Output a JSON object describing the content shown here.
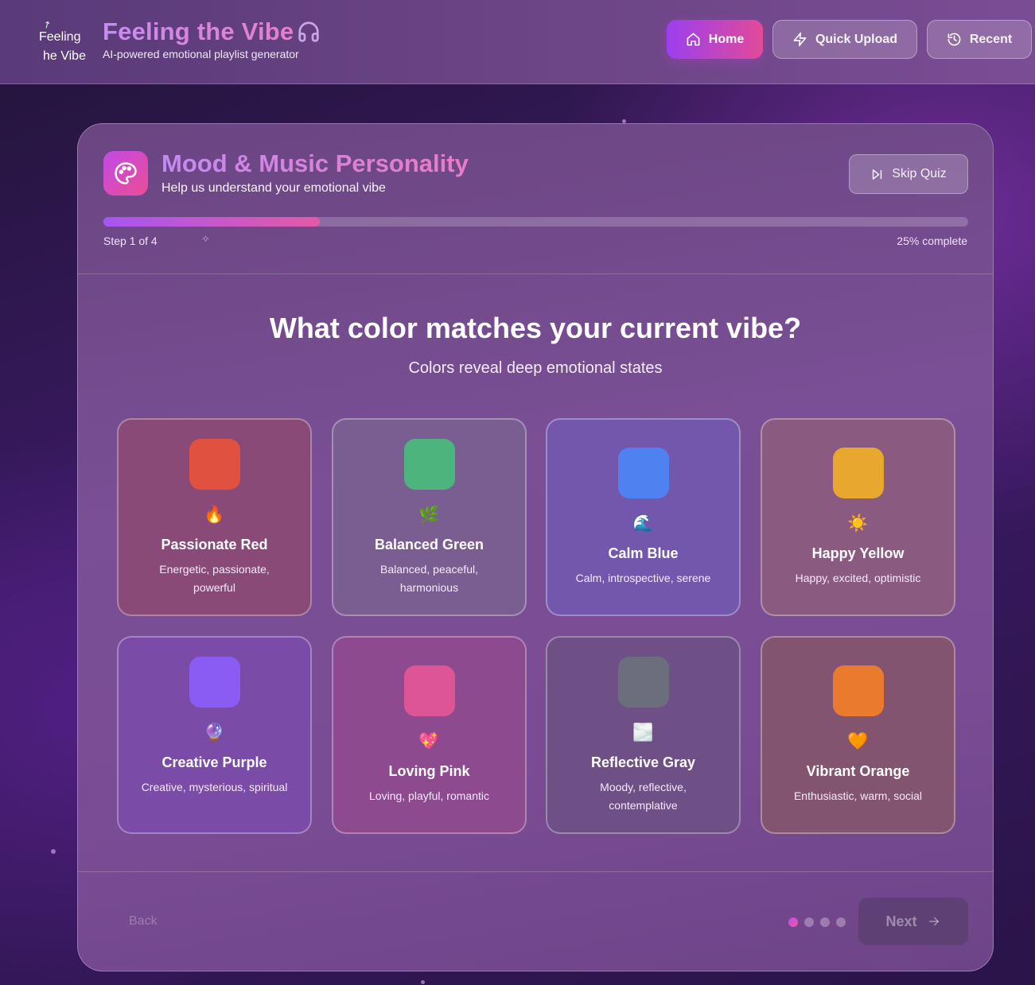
{
  "header": {
    "logo_line1": "Feeling",
    "logo_line2": "he Vibe",
    "title": "Feeling the Vibe",
    "subtitle": "AI-powered emotional playlist generator",
    "nav": {
      "home": "Home",
      "quick_upload": "Quick Upload",
      "recent": "Recent"
    }
  },
  "quiz": {
    "title": "Mood & Music Personality",
    "subtitle": "Help us understand your emotional vibe",
    "skip_label": "Skip Quiz",
    "progress_fraction": 0.25,
    "step_text": "Step 1 of 4",
    "percent_text": "25% complete",
    "question": "What color matches your current vibe?",
    "question_sub": "Colors reveal deep emotional states",
    "options": [
      {
        "name": "Passionate Red",
        "desc": "Energetic, passionate, powerful",
        "emoji": "🔥",
        "color": "#e0523f",
        "bg": "#8a4a78"
      },
      {
        "name": "Balanced Green",
        "desc": "Balanced, peaceful, harmonious",
        "emoji": "🌿",
        "color": "#4db47e",
        "bg": "#7a5e92"
      },
      {
        "name": "Calm Blue",
        "desc": "Calm, introspective, serene",
        "emoji": "🌊",
        "color": "#4f82f0",
        "bg": "#7257ad"
      },
      {
        "name": "Happy Yellow",
        "desc": "Happy, excited, optimistic",
        "emoji": "☀️",
        "color": "#e8a72f",
        "bg": "#8a5a80"
      },
      {
        "name": "Creative Purple",
        "desc": "Creative, mysterious, spiritual",
        "emoji": "🔮",
        "color": "#8b5cf4",
        "bg": "#7b4ba8"
      },
      {
        "name": "Loving Pink",
        "desc": "Loving, playful, romantic",
        "emoji": "💖",
        "color": "#dd5597",
        "bg": "#8d4a8f"
      },
      {
        "name": "Reflective Gray",
        "desc": "Moody, reflective, contemplative",
        "emoji": "🌫️",
        "color": "#6c6e7e",
        "bg": "#6e5086"
      },
      {
        "name": "Vibrant Orange",
        "desc": "Enthusiastic, warm, social",
        "emoji": "🧡",
        "color": "#ea7b2e",
        "bg": "#835470"
      }
    ],
    "back_label": "Back",
    "next_label": "Next",
    "steps_total": 4,
    "current_step": 1
  }
}
